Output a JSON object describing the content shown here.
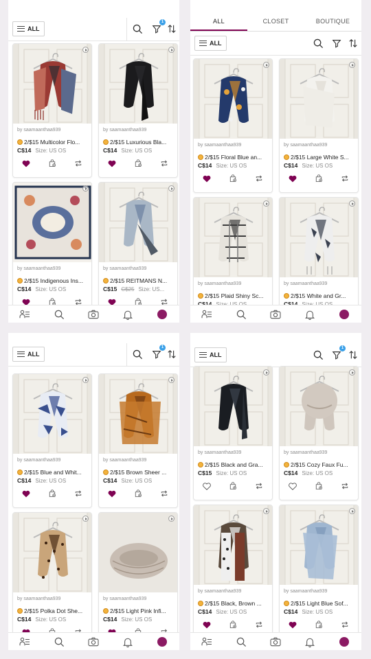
{
  "accent_color": "#7f0353",
  "screens": [
    {
      "tabs": [],
      "filter": {
        "all_label": "ALL",
        "badge": "1"
      },
      "listings": [
        {
          "seller": "by saamaanthaa939",
          "title": "2/$15 Multicolor Flo...",
          "price": "C$14",
          "orig_price": "",
          "size": "Size: US OS",
          "liked": true
        },
        {
          "seller": "by saamaanthaa939",
          "title": "2/$15 Luxurious Bla...",
          "price": "C$14",
          "orig_price": "",
          "size": "Size: US OS",
          "liked": true
        },
        {
          "seller": "by saamaanthaa939",
          "title": "2/$15 Indigenous Ins...",
          "price": "C$14",
          "orig_price": "",
          "size": "Size: US OS",
          "liked": true
        },
        {
          "seller": "by saamaanthaa939",
          "title": "2/$15 REITMANS N...",
          "price": "C$15",
          "orig_price": "C$25",
          "size": "Size: US...",
          "liked": true
        }
      ]
    },
    {
      "tabs": [
        "ALL",
        "CLOSET",
        "BOUTIQUE"
      ],
      "filter": {
        "all_label": "ALL",
        "badge": ""
      },
      "listings": [
        {
          "seller": "by saamaanthaa939",
          "title": "2/$15 Floral Blue an...",
          "price": "C$14",
          "orig_price": "",
          "size": "Size: US OS",
          "liked": true
        },
        {
          "seller": "by saamaanthaa939",
          "title": "2/$15 Large White S...",
          "price": "C$14",
          "orig_price": "",
          "size": "Size: US OS",
          "liked": true
        },
        {
          "seller": "by saamaanthaa939",
          "title": "2/$15 Plaid Shiny Sc...",
          "price": "C$14",
          "orig_price": "",
          "size": "Size: US OS",
          "liked": true
        },
        {
          "seller": "by saamaanthaa939",
          "title": "2/$15 White and Gr...",
          "price": "C$14",
          "orig_price": "",
          "size": "Size: US OS",
          "liked": true
        }
      ]
    },
    {
      "tabs": [],
      "filter": {
        "all_label": "ALL",
        "badge": "1"
      },
      "listings": [
        {
          "seller": "by saamaanthaa939",
          "title": "2/$15 Blue and Whit...",
          "price": "C$14",
          "orig_price": "",
          "size": "Size: US OS",
          "liked": true
        },
        {
          "seller": "by saamaanthaa939",
          "title": "2/$15 Brown Sheer ...",
          "price": "C$14",
          "orig_price": "",
          "size": "Size: US OS",
          "liked": true
        },
        {
          "seller": "by saamaanthaa939",
          "title": "2/$15 Polka Dot She...",
          "price": "C$14",
          "orig_price": "",
          "size": "Size: US OS",
          "liked": true
        },
        {
          "seller": "by saamaanthaa939",
          "title": "2/$15 Light Pink Infi...",
          "price": "C$14",
          "orig_price": "",
          "size": "Size: US OS",
          "liked": true
        }
      ]
    },
    {
      "tabs": [],
      "filter": {
        "all_label": "ALL",
        "badge": "1"
      },
      "listings": [
        {
          "seller": "by saamaanthaa939",
          "title": "2/$15 Black and Gra...",
          "price": "C$15",
          "orig_price": "",
          "size": "Size: US OS",
          "liked": false
        },
        {
          "seller": "by saamaanthaa939",
          "title": "2/$15 Cozy Faux Fu...",
          "price": "C$14",
          "orig_price": "",
          "size": "Size: US OS",
          "liked": false
        },
        {
          "seller": "by saamaanthaa939",
          "title": "2/$15 Black, Brown ...",
          "price": "C$14",
          "orig_price": "",
          "size": "Size: US OS",
          "liked": true
        },
        {
          "seller": "by saamaanthaa939",
          "title": "2/$15 Light Blue Sof...",
          "price": "C$14",
          "orig_price": "",
          "size": "Size: US OS",
          "liked": true
        }
      ]
    }
  ]
}
